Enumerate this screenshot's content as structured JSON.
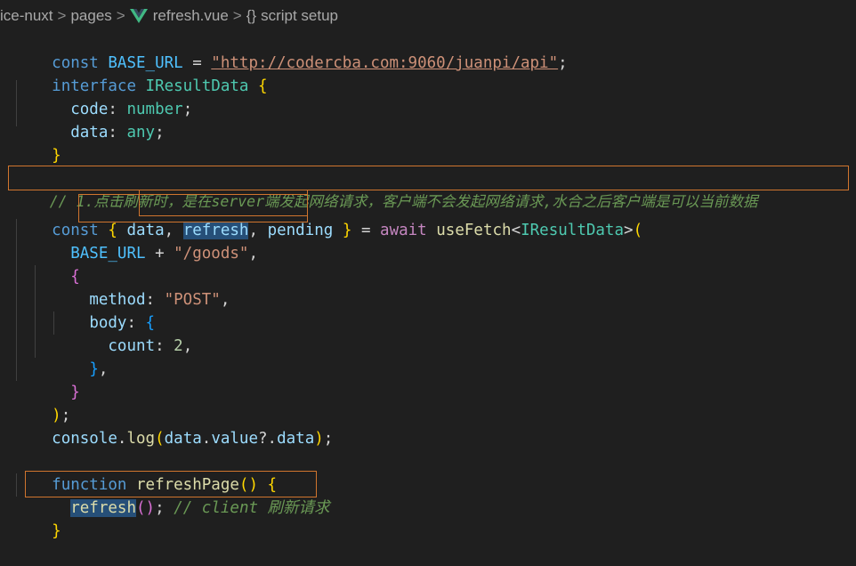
{
  "breadcrumb": {
    "items": [
      "ice-nuxt",
      "pages",
      "refresh.vue",
      "script setup"
    ],
    "separator": ">",
    "brace_glyph": "{}"
  },
  "icons": {
    "file_type": "vue-icon",
    "scope": "brace-icon"
  },
  "colors": {
    "background": "#1f1f1f",
    "keyword": "#569cd6",
    "control_keyword": "#c586c0",
    "variable": "#9cdcfe",
    "constant": "#4fc1ff",
    "type": "#4ec9b0",
    "string": "#ce9178",
    "number": "#b5cea8",
    "function": "#dcdcaa",
    "comment": "#6a9955",
    "highlight_border": "#d0752e",
    "selection": "#264f78"
  },
  "code": {
    "lines": [
      [
        "const",
        " ",
        "BASE_URL",
        " = ",
        "\"http://codercba.com:9060/juanpi/api\"",
        ";"
      ],
      [
        "interface",
        " ",
        "IResultData",
        " ",
        "{"
      ],
      [
        "  ",
        "code",
        ": ",
        "number",
        ";"
      ],
      [
        "  ",
        "data",
        ": ",
        "any",
        ";"
      ],
      [
        "}"
      ],
      [
        ""
      ],
      [
        "// 1.点击刷新时，是在server端发起网络请求，客户端不会发起网络请求,水合之后客户端是可以当前数据"
      ],
      [
        "const",
        " ",
        "{",
        " ",
        "data",
        ", ",
        "refresh",
        ", ",
        "pending",
        " ",
        "}",
        " = ",
        "await",
        " ",
        "useFetch",
        "<",
        "IResultData",
        ">",
        "("
      ],
      [
        "  ",
        "BASE_URL",
        " + ",
        "\"/goods\"",
        ","
      ],
      [
        "  ",
        "{"
      ],
      [
        "    ",
        "method",
        ": ",
        "\"POST\"",
        ","
      ],
      [
        "    ",
        "body",
        ": ",
        "{"
      ],
      [
        "      ",
        "count",
        ": ",
        "2",
        ","
      ],
      [
        "    ",
        "}",
        ","
      ],
      [
        "  ",
        "}"
      ],
      [
        ")",
        ";"
      ],
      [
        "console",
        ".",
        "log",
        "(",
        "data",
        ".",
        "value",
        "?.",
        "data",
        ")",
        ";"
      ],
      [
        ""
      ],
      [
        "function",
        " ",
        "refreshPage",
        "(",
        ")",
        " ",
        "{"
      ],
      [
        "  ",
        "refresh",
        "(",
        ")",
        ";",
        " ",
        "// client 刷新请求"
      ],
      [
        "}"
      ]
    ]
  }
}
